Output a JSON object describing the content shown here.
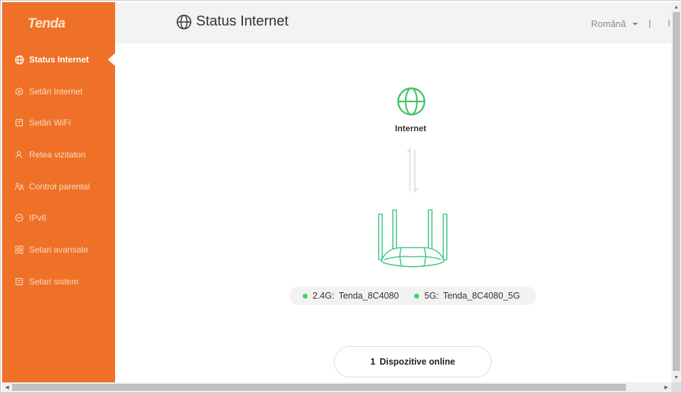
{
  "brand": {
    "logo_text": "Tenda",
    "accent": "#ee7127",
    "success": "#45d16b"
  },
  "sidebar": {
    "items": [
      {
        "label": "Status Internet",
        "icon": "globe-icon",
        "active": true
      },
      {
        "label": "Setări Internet",
        "icon": "hexagon-icon",
        "active": false
      },
      {
        "label": "Setări WiFi",
        "icon": "wifi-box-icon",
        "active": false
      },
      {
        "label": "Retea vizitatori",
        "icon": "guest-user-icon",
        "active": false
      },
      {
        "label": "Control parental",
        "icon": "parental-icon",
        "active": false
      },
      {
        "label": "IPv6",
        "icon": "ipv6-icon",
        "active": false
      },
      {
        "label": "Setari avansate",
        "icon": "grid-icon",
        "active": false
      },
      {
        "label": "Setari sistem",
        "icon": "system-icon",
        "active": false
      }
    ]
  },
  "header": {
    "title": "Status Internet",
    "language": "Română",
    "sep1": "|",
    "sep2": "I"
  },
  "main": {
    "internet_label": "Internet",
    "wifi": [
      {
        "band": "2.4G:",
        "ssid": "Tenda_8C4080"
      },
      {
        "band": "5G:",
        "ssid": "Tenda_8C4080_5G"
      }
    ],
    "devices": {
      "count": "1",
      "label": "Dispozitive online"
    }
  }
}
